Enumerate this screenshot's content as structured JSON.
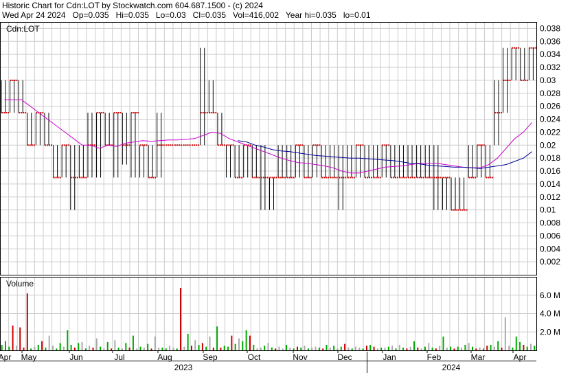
{
  "header": {
    "line1": "Historic Chart for Cdn:LOT by Stockwatch.com 604.687.1500 - (c) 2024",
    "line2": "Wed Apr 24 2024   Op=0.035   Hi=0.035   Lo=0.03   Cl=0.035   Vol=416,002   Year hi=0.035   lo=0.01"
  },
  "colors": {
    "up_bar": "#000000",
    "down_tick": "#cc0000",
    "ma_short": "#cc00cc",
    "ma_long": "#000099",
    "vol_up": "#00aa00",
    "vol_down": "#cc0000",
    "vol_flat": "#aaaaaa",
    "grid": "#cccccc"
  },
  "chart_data": [
    {
      "type": "ohlc",
      "label": "Cdn:LOT",
      "ylim": [
        0,
        0.039
      ],
      "y_ticks": [
        "0.038",
        "0.036",
        "0.034",
        "0.032",
        "0.03",
        "0.028",
        "0.026",
        "0.024",
        "0.022",
        "0.02",
        "0.018",
        "0.016",
        "0.014",
        "0.012",
        "0.01",
        "0.008",
        "0.006",
        "0.004",
        "0.002"
      ],
      "y_tick_values": [
        0.038,
        0.036,
        0.034,
        0.032,
        0.03,
        0.028,
        0.026,
        0.024,
        0.022,
        0.02,
        0.018,
        0.016,
        0.014,
        0.012,
        0.01,
        0.008,
        0.006,
        0.004,
        0.002
      ],
      "x_range": [
        "2023-04-24",
        "2024-04-24"
      ],
      "weeks": [
        {
          "lo": 0.025,
          "hi": 0.03,
          "cl": 0.025
        },
        {
          "lo": 0.025,
          "hi": 0.03,
          "cl": 0.03
        },
        {
          "lo": 0.025,
          "hi": 0.03,
          "cl": 0.025
        },
        {
          "lo": 0.02,
          "hi": 0.025,
          "cl": 0.02
        },
        {
          "lo": 0.02,
          "hi": 0.025,
          "cl": 0.025
        },
        {
          "lo": 0.02,
          "hi": 0.025,
          "cl": 0.02
        },
        {
          "lo": 0.015,
          "hi": 0.02,
          "cl": 0.015
        },
        {
          "lo": 0.015,
          "hi": 0.02,
          "cl": 0.02
        },
        {
          "lo": 0.01,
          "hi": 0.02,
          "cl": 0.015
        },
        {
          "lo": 0.015,
          "hi": 0.02,
          "cl": 0.015
        },
        {
          "lo": 0.015,
          "hi": 0.025,
          "cl": 0.02
        },
        {
          "lo": 0.015,
          "hi": 0.025,
          "cl": 0.025
        },
        {
          "lo": 0.02,
          "hi": 0.025,
          "cl": 0.02
        },
        {
          "lo": 0.015,
          "hi": 0.025,
          "cl": 0.025
        },
        {
          "lo": 0.017,
          "hi": 0.025,
          "cl": 0.02
        },
        {
          "lo": 0.015,
          "hi": 0.025,
          "cl": 0.025
        },
        {
          "lo": 0.015,
          "hi": 0.02,
          "cl": 0.02
        },
        {
          "lo": 0.015,
          "hi": 0.02,
          "cl": 0.015
        },
        {
          "lo": 0.015,
          "hi": 0.025,
          "cl": 0.02
        },
        {
          "lo": 0.02,
          "hi": 0.02,
          "cl": 0.02
        },
        {
          "lo": 0.02,
          "hi": 0.02,
          "cl": 0.02
        },
        {
          "lo": 0.02,
          "hi": 0.02,
          "cl": 0.02
        },
        {
          "lo": 0.02,
          "hi": 0.02,
          "cl": 0.02
        },
        {
          "lo": 0.02,
          "hi": 0.035,
          "cl": 0.025
        },
        {
          "lo": 0.025,
          "hi": 0.03,
          "cl": 0.025
        },
        {
          "lo": 0.02,
          "hi": 0.025,
          "cl": 0.02
        },
        {
          "lo": 0.015,
          "hi": 0.02,
          "cl": 0.02
        },
        {
          "lo": 0.015,
          "hi": 0.02,
          "cl": 0.015
        },
        {
          "lo": 0.015,
          "hi": 0.02,
          "cl": 0.02
        },
        {
          "lo": 0.015,
          "hi": 0.02,
          "cl": 0.015
        },
        {
          "lo": 0.01,
          "hi": 0.02,
          "cl": 0.015
        },
        {
          "lo": 0.01,
          "hi": 0.015,
          "cl": 0.015
        },
        {
          "lo": 0.015,
          "hi": 0.02,
          "cl": 0.015
        },
        {
          "lo": 0.015,
          "hi": 0.02,
          "cl": 0.015
        },
        {
          "lo": 0.015,
          "hi": 0.02,
          "cl": 0.02
        },
        {
          "lo": 0.015,
          "hi": 0.02,
          "cl": 0.015
        },
        {
          "lo": 0.015,
          "hi": 0.02,
          "cl": 0.02
        },
        {
          "lo": 0.015,
          "hi": 0.02,
          "cl": 0.015
        },
        {
          "lo": 0.015,
          "hi": 0.02,
          "cl": 0.015
        },
        {
          "lo": 0.01,
          "hi": 0.02,
          "cl": 0.015
        },
        {
          "lo": 0.015,
          "hi": 0.02,
          "cl": 0.015
        },
        {
          "lo": 0.015,
          "hi": 0.02,
          "cl": 0.02
        },
        {
          "lo": 0.015,
          "hi": 0.02,
          "cl": 0.015
        },
        {
          "lo": 0.015,
          "hi": 0.02,
          "cl": 0.015
        },
        {
          "lo": 0.015,
          "hi": 0.02,
          "cl": 0.02
        },
        {
          "lo": 0.015,
          "hi": 0.02,
          "cl": 0.015
        },
        {
          "lo": 0.015,
          "hi": 0.02,
          "cl": 0.015
        },
        {
          "lo": 0.015,
          "hi": 0.02,
          "cl": 0.015
        },
        {
          "lo": 0.015,
          "hi": 0.02,
          "cl": 0.015
        },
        {
          "lo": 0.015,
          "hi": 0.02,
          "cl": 0.015
        },
        {
          "lo": 0.01,
          "hi": 0.02,
          "cl": 0.015
        },
        {
          "lo": 0.01,
          "hi": 0.015,
          "cl": 0.015
        },
        {
          "lo": 0.01,
          "hi": 0.015,
          "cl": 0.01
        },
        {
          "lo": 0.01,
          "hi": 0.015,
          "cl": 0.01
        },
        {
          "lo": 0.015,
          "hi": 0.02,
          "cl": 0.015
        },
        {
          "lo": 0.015,
          "hi": 0.02,
          "cl": 0.02
        },
        {
          "lo": 0.015,
          "hi": 0.02,
          "cl": 0.015
        },
        {
          "lo": 0.02,
          "hi": 0.03,
          "cl": 0.025
        },
        {
          "lo": 0.025,
          "hi": 0.035,
          "cl": 0.03
        },
        {
          "lo": 0.03,
          "hi": 0.035,
          "cl": 0.035
        },
        {
          "lo": 0.03,
          "hi": 0.035,
          "cl": 0.03
        },
        {
          "lo": 0.03,
          "hi": 0.035,
          "cl": 0.035
        }
      ],
      "ma_short": [
        0.027,
        0.027,
        0.027,
        0.026,
        0.025,
        0.024,
        0.023,
        0.022,
        0.021,
        0.02,
        0.02,
        0.0195,
        0.02,
        0.0198,
        0.0203,
        0.0205,
        0.0207,
        0.0206,
        0.0207,
        0.0208,
        0.0208,
        0.0209,
        0.021,
        0.0215,
        0.022,
        0.0218,
        0.021,
        0.0205,
        0.02,
        0.0195,
        0.019,
        0.0185,
        0.018,
        0.0176,
        0.0173,
        0.0172,
        0.017,
        0.0168,
        0.0165,
        0.016,
        0.0157,
        0.0157,
        0.016,
        0.0163,
        0.0166,
        0.0167,
        0.0168,
        0.017,
        0.0172,
        0.0172,
        0.0172,
        0.017,
        0.0168,
        0.0166,
        0.0165,
        0.0165,
        0.017,
        0.018,
        0.0195,
        0.021,
        0.022,
        0.0235
      ],
      "ma_long_start": 27,
      "ma_long": [
        0.0207,
        0.0205,
        0.02,
        0.0197,
        0.0193,
        0.0191,
        0.019,
        0.0188,
        0.0186,
        0.0184,
        0.0183,
        0.0182,
        0.0181,
        0.018,
        0.018,
        0.0179,
        0.0178,
        0.0177,
        0.0176,
        0.0174,
        0.0172,
        0.0171,
        0.0169,
        0.0168,
        0.0167,
        0.0166,
        0.0166,
        0.0165,
        0.0164,
        0.0166,
        0.0168,
        0.017,
        0.0175,
        0.018,
        0.019
      ]
    },
    {
      "type": "bar",
      "label": "Volume",
      "ylim": [
        0,
        8
      ],
      "y_ticks": [
        "6.0 M",
        "4.0 M",
        "2.0 M"
      ],
      "y_tick_values": [
        6,
        4,
        2
      ],
      "unit": "M",
      "values": [
        0.6,
        1.0,
        0.4,
        2.7,
        0.5,
        2.5,
        0.3,
        6.2,
        0.2,
        0.4,
        0.6,
        1.0,
        0.3,
        1.6,
        0.5,
        0.2,
        0.8,
        0.4,
        2.2,
        0.6,
        0.3,
        0.8,
        0.9,
        0.2,
        0.5,
        0.3,
        1.3,
        0.4,
        0.2,
        0.9,
        0.2,
        1.1,
        0.3,
        0.2,
        0.8,
        0.3,
        1.6,
        0.2,
        0.4,
        0.3,
        0.7,
        0.2,
        1.5,
        0.3,
        0.3,
        0.2,
        0.5,
        0.3,
        0.2,
        6.8,
        0.4,
        1.8,
        0.5,
        1.1,
        0.6,
        0.8,
        0.4,
        1.5,
        0.3,
        2.6,
        0.3,
        0.5,
        0.4,
        1.6,
        0.7,
        1.3,
        1.0,
        2.2,
        1.6,
        0.6,
        0.2,
        0.3,
        0.5,
        0.8,
        0.3,
        0.2,
        0.4,
        0.2,
        0.6,
        0.3,
        0.2,
        0.4,
        0.3,
        0.5,
        0.2,
        0.3,
        0.4,
        0.3,
        0.2,
        0.6,
        0.3,
        0.5,
        0.2,
        0.4,
        0.7,
        0.3,
        0.2,
        0.4,
        0.3,
        0.2,
        0.5,
        0.6,
        0.4,
        0.2,
        0.3,
        0.3,
        0.4,
        0.5,
        0.2,
        0.6,
        0.3,
        0.2,
        0.4,
        1.0,
        0.3,
        0.2,
        0.4,
        0.8,
        0.3,
        0.2,
        0.5,
        1.5,
        0.3,
        0.4,
        0.2,
        0.4,
        0.3,
        0.6,
        0.8,
        0.4,
        0.2,
        0.3,
        0.2,
        0.5,
        0.6,
        0.4,
        1.0,
        0.3,
        3.6,
        0.5,
        0.3,
        1.5,
        0.9,
        0.6,
        0.4,
        0.7,
        0.5
      ],
      "colors": "gggrkrrrgkgrgkkggkggrgkgkrkgkgrkgkgrgkgkgrkkggkkgrkgrkgrgkrgrggrgkggrgkkgkgrkkgkgrgkgkkgrgkgkgrkgkkgrgrkgkgkgkgrkgrkgkgrkgkgrgkgkgrkgrgkgrkkgggrgkggr"
    }
  ],
  "x_axis": {
    "months": [
      "Apr",
      "May",
      "Jun",
      "Jul",
      "Aug",
      "Sep",
      "Oct",
      "Nov",
      "Dec",
      "Jan",
      "Feb",
      "Mar",
      "Apr"
    ],
    "years": [
      "2023",
      "2024"
    ]
  }
}
